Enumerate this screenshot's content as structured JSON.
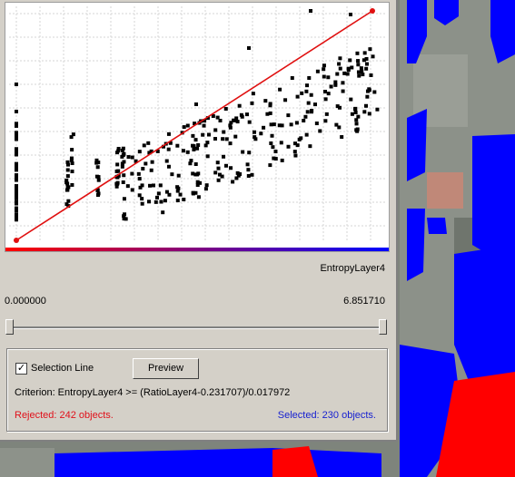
{
  "plot": {
    "x_axis_label": "EntropyLayer4",
    "gradient_start_color": "#ff0000",
    "gradient_end_color": "#0000ff",
    "line_color": "#e01010",
    "points_color": "#000000"
  },
  "range": {
    "min": "0.000000",
    "max": "6.851710"
  },
  "slider": {
    "lower_fraction": 0.0,
    "upper_fraction": 1.0
  },
  "options": {
    "selection_line_checked": true,
    "selection_line_label": "Selection Line",
    "checkbox_mark": "✓",
    "preview_label": "Preview",
    "criterion": "Criterion: EntropyLayer4 >= (RatioLayer4-0.231707)/0.017972"
  },
  "status": {
    "rejected": "Rejected: 242 objects.",
    "selected": "Selected: 230 objects.",
    "rejected_color": "#e0101a",
    "selected_color": "#1822d0"
  },
  "background": {
    "segment_color_blue": "#0000ff",
    "segment_color_red": "#ff0000"
  }
}
